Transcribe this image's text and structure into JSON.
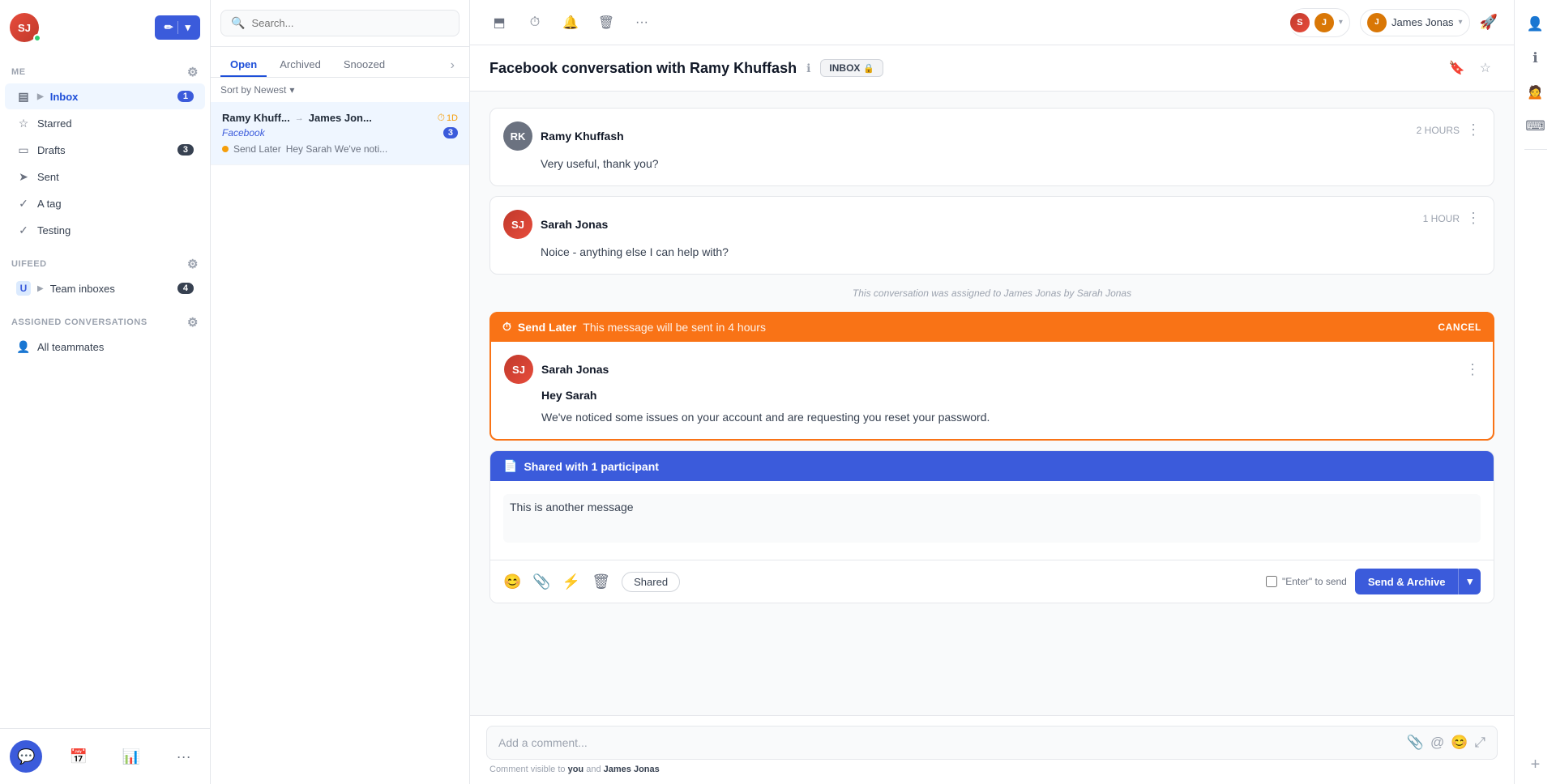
{
  "sidebar": {
    "user_initials": "SJ",
    "compose_label": "✏",
    "me_label": "Me",
    "gear_label": "⚙",
    "nav_items": [
      {
        "id": "inbox",
        "label": "Inbox",
        "icon": "inbox",
        "badge": "1",
        "active": true
      },
      {
        "id": "starred",
        "label": "Starred",
        "icon": "star",
        "badge": null
      },
      {
        "id": "drafts",
        "label": "Drafts",
        "icon": "draft",
        "badge": "3"
      },
      {
        "id": "sent",
        "label": "Sent",
        "icon": "sent",
        "badge": null
      },
      {
        "id": "a-tag",
        "label": "A tag",
        "icon": "tag",
        "badge": null
      },
      {
        "id": "testing",
        "label": "Testing",
        "icon": "tag",
        "badge": null
      }
    ],
    "section_uifeed": "uifeed",
    "team_inboxes_label": "Team inboxes",
    "team_inboxes_badge": "4",
    "assigned_conversations_label": "Assigned conversations",
    "all_teammates_label": "All teammates"
  },
  "conv_list": {
    "search_placeholder": "Search...",
    "tabs": [
      "Open",
      "Archived",
      "Snoozed"
    ],
    "active_tab": "Open",
    "sort_label": "Sort by Newest",
    "conversations": [
      {
        "id": "conv1",
        "from": "Ramy Khuff...",
        "to": "James Jon...",
        "channel": "Facebook",
        "badge": "3",
        "timer": "1D",
        "send_later_label": "Send Later",
        "send_later_preview": "Hey Sarah We've noti...",
        "active": true
      }
    ]
  },
  "main": {
    "header_icons": [
      "archive",
      "clock",
      "bell",
      "trash",
      "more"
    ],
    "title": "Facebook conversation with Ramy Khuffash",
    "inbox_badge": "INBOX",
    "messages": [
      {
        "id": "msg1",
        "sender": "Ramy Khuffash",
        "sender_initials": "RK",
        "time": "2 HOURS",
        "body": "Very useful, thank you?"
      },
      {
        "id": "msg2",
        "sender": "Sarah Jonas",
        "sender_initials": "SJ",
        "time": "1 HOUR",
        "body": "Noice - anything else I can help with?"
      }
    ],
    "system_message": "This conversation was assigned to James Jonas by Sarah Jonas",
    "send_later_banner": {
      "label": "Send Later",
      "description": "This message will be sent in 4 hours",
      "cancel_label": "CANCEL",
      "sender": "Sarah Jonas",
      "sender_initials": "SJ",
      "greeting": "Hey Sarah",
      "body": "We've noticed some issues on your account and are requesting you reset your password."
    },
    "shared_section": {
      "header": "Shared with 1 participant",
      "message": "This is another message",
      "shared_badge_label": "Shared",
      "enter_to_send_label": "\"Enter\" to send",
      "send_archive_label": "Send & Archive"
    },
    "comment_placeholder": "Add a comment...",
    "comment_note_prefix": "Comment visible to ",
    "comment_note_you": "you",
    "comment_note_and": " and ",
    "comment_note_user": "James Jonas"
  },
  "header": {
    "avatar_s": "S",
    "avatar_j": "J",
    "user_name": "James Jonas",
    "compose_icon": "🚀"
  },
  "right_sidebar": {
    "icons": [
      "contact",
      "info",
      "person",
      "keyboard"
    ],
    "add_label": "+"
  }
}
